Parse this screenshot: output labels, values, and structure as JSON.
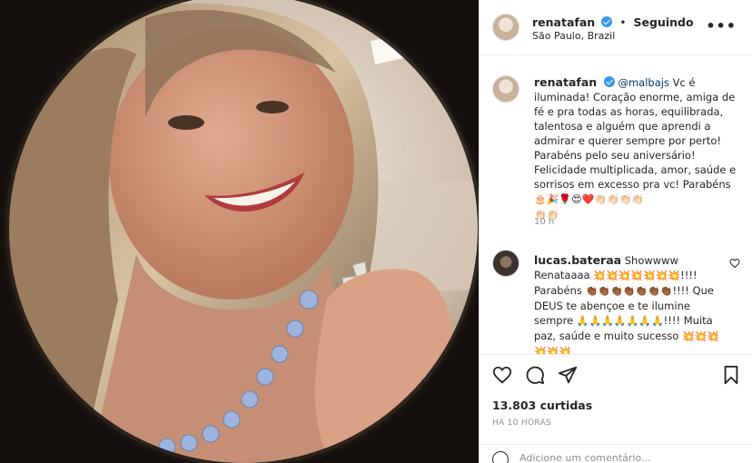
{
  "post": {
    "username": "renatafan",
    "follow_status": "Seguindo",
    "separator": "•",
    "location": "São Paulo, Brazil",
    "more_label": "•••"
  },
  "caption": {
    "username": "renatafan",
    "mention": "@malbajs",
    "text": " Vc é iluminada! Coração enorme, amiga de fé e pra todas as horas, equilibrada, talentosa e alguém que aprendi a admirar e querer sempre por perto! Parabéns pelo seu aniversário! Felicidade multiplicada, amor, saúde e sorrisos em excesso pra vc! Parabéns ",
    "emojis_1": "🎂🎉🌹😍❤️👏🏻👏🏻👏🏻👏🏻",
    "emojis_2": "👏🏻👏🏻",
    "time": "10 h"
  },
  "comment": {
    "username": "lucas.bateraa",
    "text_1": " Showwww Renataaaa ",
    "emojis_a": "💥💥💥💥💥💥💥",
    "text_2": "!!!! Parabéns ",
    "emojis_b": "👏🏾👏🏾👏🏾👏🏾👏🏾👏🏾👏🏾",
    "text_3": "!!!! Que DEUS te abençoe e te ilumine sempre ",
    "emojis_c": "🙏🙏🙏🙏🙏🙏🙏",
    "text_4": "!!!! Muita paz, saúde e muito sucesso ",
    "emojis_d": "💥💥💥💥💥💥"
  },
  "actions": {
    "likes": "13.803 curtidas",
    "ago": "HÁ 10 HORAS",
    "comment_placeholder": "Adicione um comentário..."
  },
  "icons": {
    "like": "heart-icon",
    "comment": "comment-icon",
    "share": "share-icon",
    "save": "bookmark-icon",
    "more": "more-options-icon",
    "emoji": "emoji-icon"
  },
  "colors": {
    "verified": "#3897f0",
    "mention": "#00376b",
    "muted": "#8e8e8e",
    "text": "#262626"
  }
}
